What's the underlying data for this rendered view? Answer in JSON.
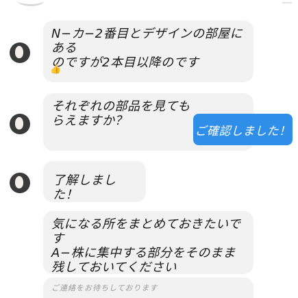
{
  "messages": [
    {
      "text": "N−カ−2番目とデザインの部屋にある\nのですが2本目以降のです",
      "emoji": "👍"
    },
    {
      "text": "それぞれの部品を見てもらえますか？"
    },
    {
      "text": "了解しました！"
    },
    {
      "text": "気になる所をまとめておきたいです\nA−株に集中する部分をそのまま\n残しておいてください"
    },
    {
      "text": "ご連絡をお待ちしております"
    }
  ],
  "cta": {
    "label": "ご確認しました！"
  },
  "colors": {
    "bubble": "#f2f2f2",
    "cta": "#2f8ee8",
    "avatar": "#3a3a3a"
  }
}
